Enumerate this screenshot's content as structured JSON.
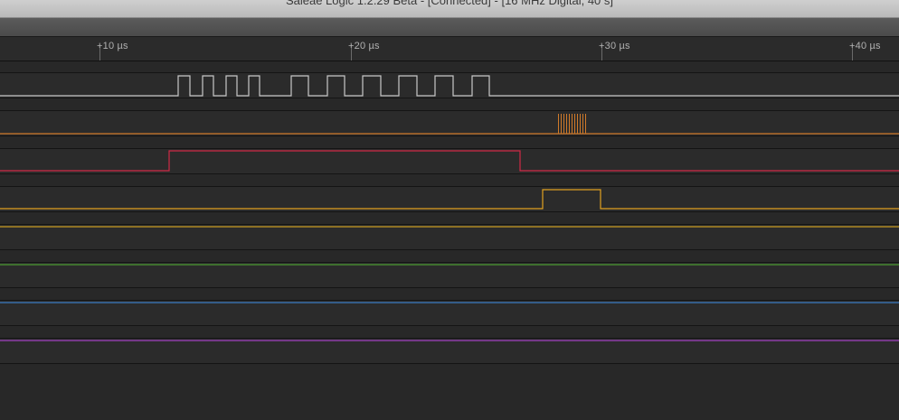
{
  "window": {
    "title": "Saleae Logic 1.2.29 Beta - [Connected] - [16 MHz Digital, 40 s]"
  },
  "timeline": {
    "ticks": [
      {
        "label": "+10 µs",
        "us": 10
      },
      {
        "label": "+20 µs",
        "us": 20
      },
      {
        "label": "+30 µs",
        "us": 30
      },
      {
        "label": "+40 µs",
        "us": 40
      }
    ]
  },
  "channels": [
    {
      "id": 0,
      "color": "#c8c8c8"
    },
    {
      "id": 1,
      "color": "#d07a2a"
    },
    {
      "id": 2,
      "color": "#d02a46"
    },
    {
      "id": 3,
      "color": "#e0a020"
    },
    {
      "id": 4,
      "color": "#c89a20"
    },
    {
      "id": 5,
      "color": "#4a9a30"
    },
    {
      "id": 6,
      "color": "#3a7ac0"
    },
    {
      "id": 7,
      "color": "#a040c0"
    }
  ]
}
